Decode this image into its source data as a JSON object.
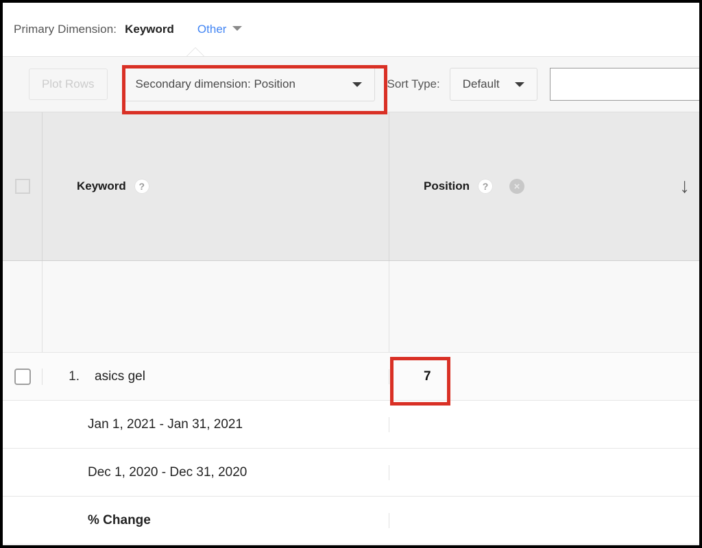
{
  "primary": {
    "label": "Primary Dimension:",
    "value": "Keyword",
    "other": "Other",
    "dropdown_icon": "chevron-down-icon"
  },
  "toolbar": {
    "plot_rows": "Plot Rows",
    "secondary_dimension": "Secondary dimension: Position",
    "sort_type_label": "Sort Type:",
    "sort_type_value": "Default",
    "search_value": "",
    "search_placeholder": ""
  },
  "table": {
    "columns": [
      {
        "name": "checkbox",
        "label": ""
      },
      {
        "name": "keyword",
        "label": "Keyword",
        "help": "?"
      },
      {
        "name": "position",
        "label": "Position",
        "help": "?",
        "remove": "×",
        "sort": "↓"
      }
    ],
    "rows": [
      {
        "type": "total",
        "index": "",
        "keyword": "",
        "position": ""
      },
      {
        "type": "main",
        "index": "1.",
        "keyword": "asics gel",
        "position": "7"
      },
      {
        "type": "sub",
        "keyword": "Jan 1, 2021 - Jan 31, 2021",
        "position": ""
      },
      {
        "type": "sub",
        "keyword": "Dec 1, 2020 - Dec 31, 2020",
        "position": ""
      },
      {
        "type": "sub",
        "keyword": "% Change",
        "position": "",
        "bold": true
      }
    ]
  },
  "annotations": {
    "color": "#d93025",
    "items": [
      {
        "name": "secondary-dimension-highlight"
      },
      {
        "name": "position-value-highlight"
      }
    ]
  }
}
